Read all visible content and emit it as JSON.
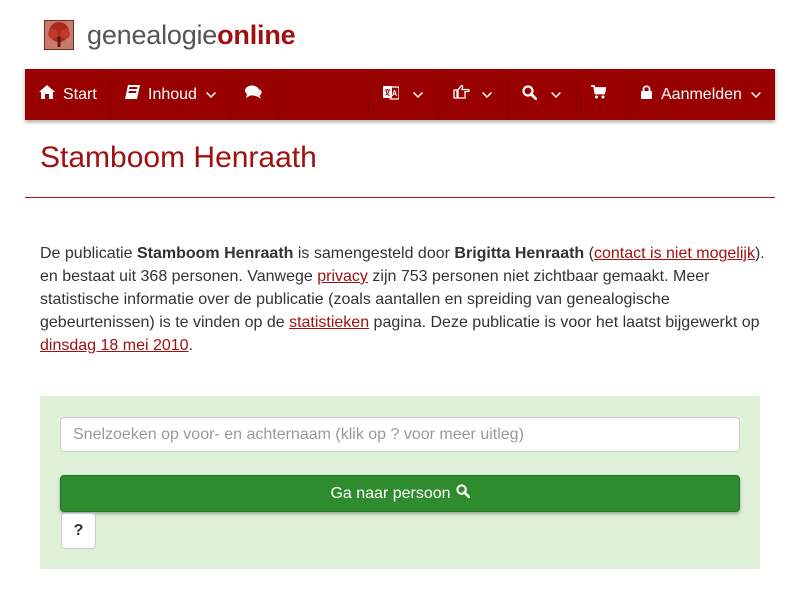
{
  "logo": {
    "part1": "genealogie",
    "part2": "online",
    "icon": "tree-icon"
  },
  "navbar": {
    "start_label": "Start",
    "inhoud_label": "Inhoud",
    "aanmelden_label": "Aanmelden",
    "icons": [
      "home-icon",
      "book-icon",
      "comments-icon",
      "language-icon",
      "share-icon",
      "search-icon",
      "cart-icon",
      "lock-icon"
    ]
  },
  "page": {
    "title": "Stamboom Henraath"
  },
  "intro": {
    "t1": "De publicatie ",
    "publication": "Stamboom Henraath",
    "t2": " is samengesteld door ",
    "author": "Brigitta Henraath",
    "t3": " (",
    "contact_link": "contact is niet mogelijk",
    "t4": "). en bestaat uit 368 personen. Vanwege ",
    "privacy_link": "privacy",
    "t5": " zijn 753 personen niet zichtbaar gemaakt. Meer statistische informatie over de publicatie (zoals aantallen en spreiding van genealogische gebeurtenissen) is te vinden op de ",
    "stats_link": "statistieken",
    "t6": " pagina. Deze publicatie is voor het laatst bijgewerkt op ",
    "date_link": "dinsdag 18 mei 2010",
    "t7": "."
  },
  "search": {
    "placeholder": "Snelzoeken op voor- en achternaam (klik op ? voor meer uitleg)",
    "value": "",
    "go_label": "Ga naar persoon",
    "help_label": "?"
  },
  "colors": {
    "brand": "#990000",
    "link": "#a01010",
    "panel": "#dff0d8",
    "button": "#2e8b2e"
  }
}
